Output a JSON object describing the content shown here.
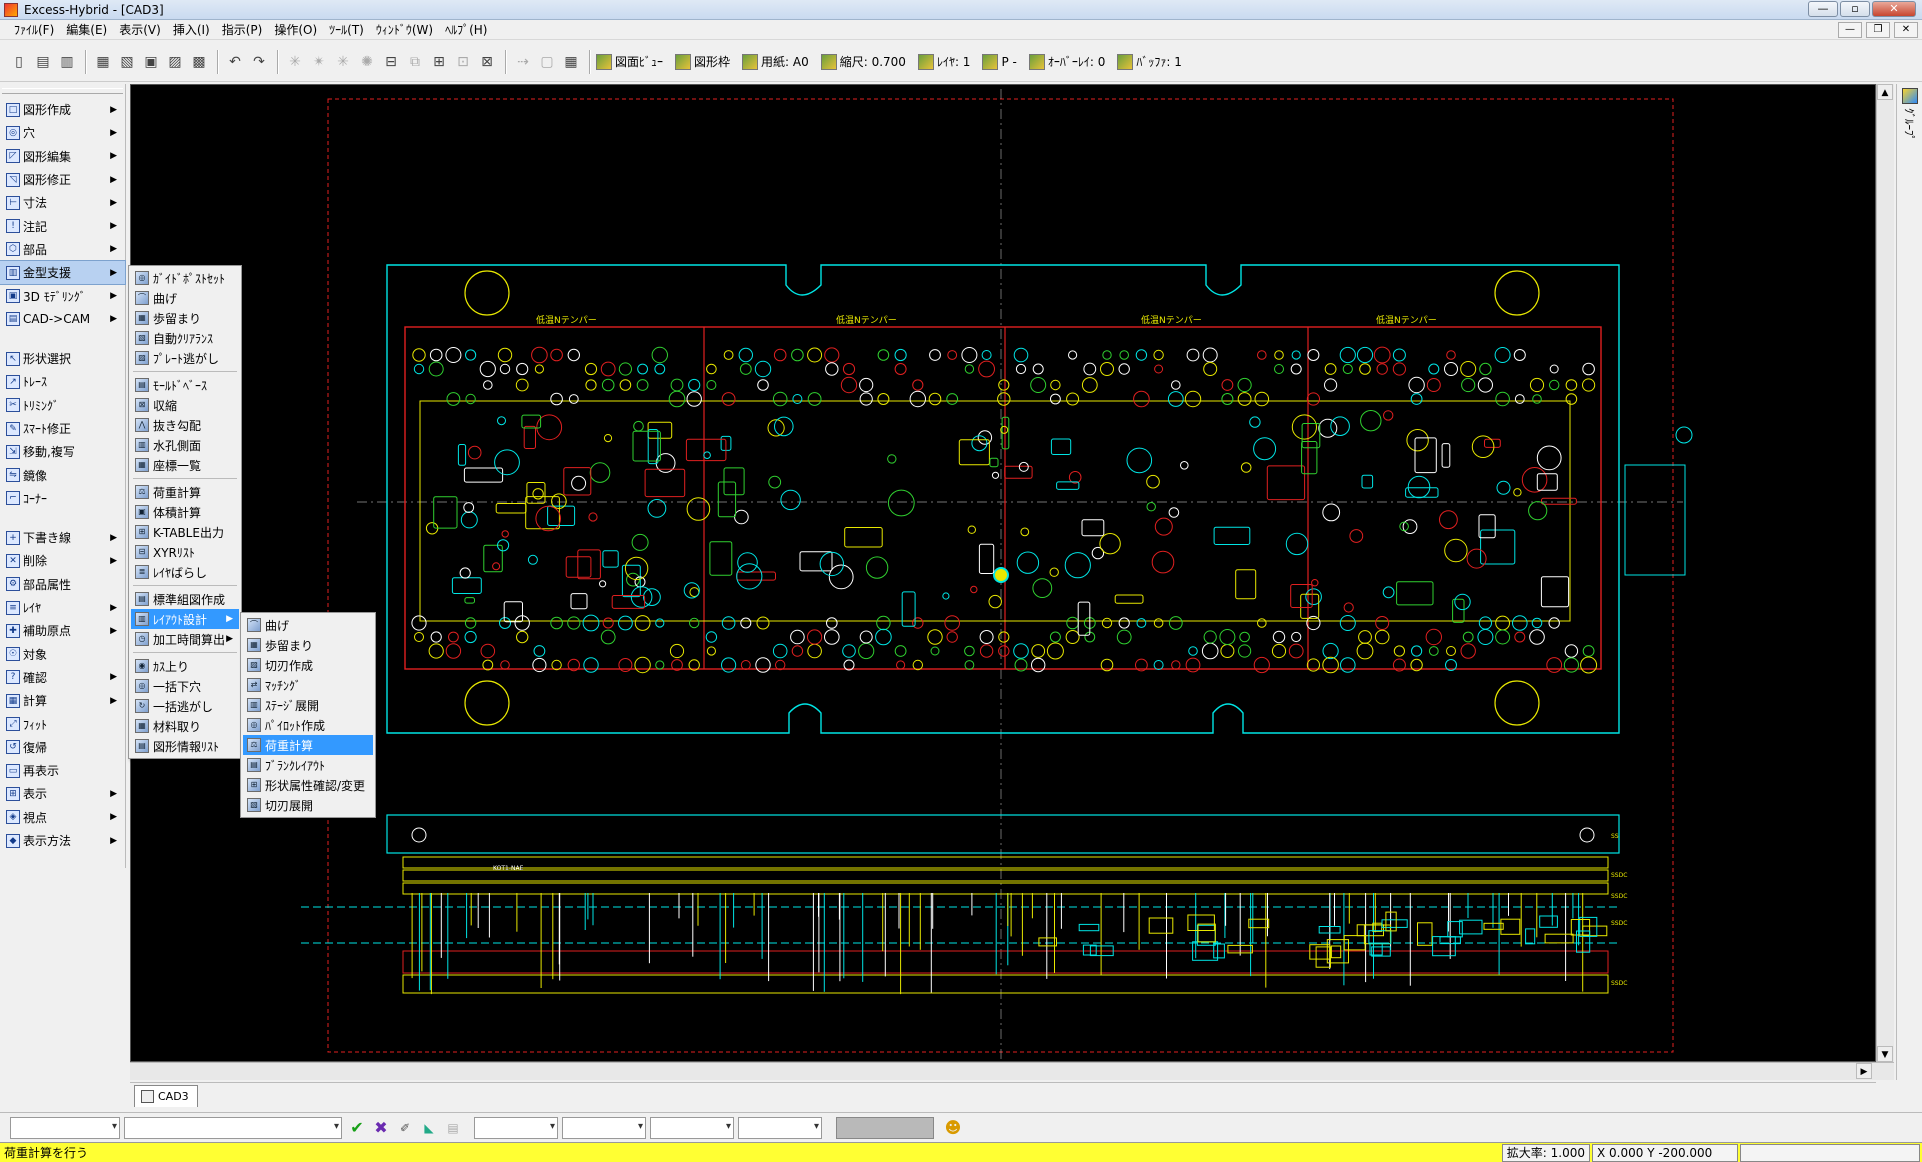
{
  "window": {
    "title": "Excess-Hybrid - [CAD3]",
    "min": "—",
    "max": "▫",
    "close": "✕"
  },
  "mdi": {
    "min": "—",
    "restore": "❐",
    "close": "✕"
  },
  "menu": [
    "ﾌｧｲﾙ(F)",
    "編集(E)",
    "表示(V)",
    "挿入(I)",
    "指示(P)",
    "操作(O)",
    "ﾂｰﾙ(T)",
    "ｳｨﾝﾄﾞｳ(W)",
    "ﾍﾙﾌﾟ(H)"
  ],
  "toolbar": {
    "view": "図面ﾋﾞｭｰ",
    "frame": "図形枠",
    "paper": "用紙: A0",
    "scale": "縮尺: 0.700",
    "layer": "ﾚｲﾔ: 1",
    "pen": "P -",
    "overlay": "ｵｰﾊﾞｰﾚｲ: 0",
    "buffer": "ﾊﾞｯﾌｧ: 1"
  },
  "left": {
    "group1": [
      "図形作成",
      "穴",
      "図形編集",
      "図形修正",
      "寸法",
      "注記",
      "部品",
      "金型支援",
      "3D ﾓﾃﾞﾘﾝｸﾞ",
      "CAD->CAM"
    ],
    "group2": [
      "形状選択",
      "ﾄﾚｰｽ",
      "ﾄﾘﾐﾝｸﾞ",
      "ｽﾏｰﾄ修正",
      "移動,複写",
      "鏡像",
      "ｺｰﾅｰ"
    ],
    "group3": [
      "下書き線",
      "削除",
      "部品属性",
      "ﾚｲﾔ",
      "補助原点",
      "対象",
      "確認",
      "計算",
      "ﾌｨｯﾄ",
      "復帰",
      "再表示",
      "表示",
      "視点",
      "表示方法"
    ]
  },
  "sub1": {
    "g1": [
      "ｶﾞｲﾄﾞﾎﾟｽﾄｾｯﾄ",
      "曲げ",
      "歩留まり",
      "自動ｸﾘｱﾗﾝｽ",
      "ﾌﾟﾚｰﾄ逃がし"
    ],
    "g2": [
      "ﾓｰﾙﾄﾞﾍﾞｰｽ",
      "収縮",
      "抜き勾配",
      "水孔側面",
      "座標一覧"
    ],
    "g3": [
      "荷重計算",
      "体積計算",
      "K-TABLE出力",
      "XYRﾘｽﾄ",
      "ﾚｲﾔばらし"
    ],
    "g4": [
      "標準組図作成",
      "ﾚｲｱｳﾄ設計",
      "加工時間算出"
    ],
    "g5": [
      "ｶｽ上り",
      "一括下穴",
      "一括逃がし",
      "材料取り",
      "図形情報ﾘｽﾄ"
    ]
  },
  "sub2": [
    "曲げ",
    "歩留まり",
    "切刃作成",
    "ﾏｯﾁﾝｸﾞ",
    "ｽﾃｰｼﾞ展開",
    "ﾊﾟｲﾛｯﾄ作成",
    "荷重計算",
    "ﾌﾞﾗﾝｸﾚｲｱｳﾄ",
    "形状属性確認/変更",
    "切刃展開"
  ],
  "right": {
    "label": "ｸﾞﾙｰﾌﾟ"
  },
  "drawing": {
    "label_temper": "低温Nテンパー",
    "label_side": "KOT1-NAE",
    "edge": [
      "SS",
      "SSDC",
      "SSDC",
      "SSDC",
      "SSDC"
    ]
  },
  "tab": {
    "name": "CAD3"
  },
  "status": {
    "message": "荷重計算を行う",
    "zoom": "拡大率: 1.000",
    "coord": "X 0.000 Y -200.000"
  },
  "colors": {
    "canvas": "#000000",
    "cyan": "#00e5e5",
    "red": "#e02020",
    "yellow": "#e8e800",
    "green": "#30d030",
    "white": "#ffffff",
    "status": "#ffff33",
    "highlight": "#3399ff"
  }
}
